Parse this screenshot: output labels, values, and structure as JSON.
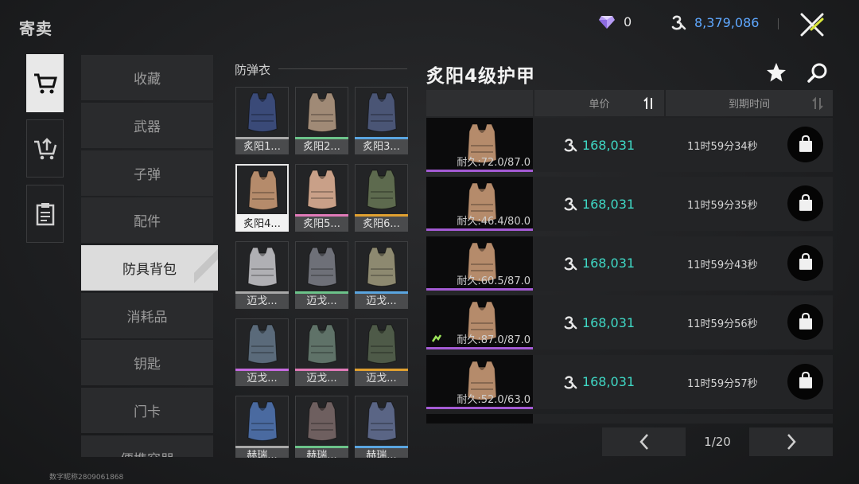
{
  "header": {
    "title": "寄卖",
    "gems": "0",
    "gold": "8,379,086"
  },
  "categories": [
    {
      "label": "收藏"
    },
    {
      "label": "武器"
    },
    {
      "label": "子弹"
    },
    {
      "label": "配件"
    },
    {
      "label": "防具背包"
    },
    {
      "label": "消耗品"
    },
    {
      "label": "钥匙"
    },
    {
      "label": "门卡"
    },
    {
      "label": "便携容器"
    }
  ],
  "grid": {
    "title": "防弹衣",
    "items": [
      {
        "label": "炙阳1...",
        "bar_color": "#a9a9a9",
        "vest_color": "#3a4a78"
      },
      {
        "label": "炙阳2...",
        "bar_color": "#6cc38a",
        "vest_color": "#a08a76"
      },
      {
        "label": "炙阳3...",
        "bar_color": "#5aa5e0",
        "vest_color": "#4a5575"
      },
      {
        "label": "炙阳4...",
        "bar_color": "#f2f2f2",
        "vest_color": "#b58b6b"
      },
      {
        "label": "炙阳5...",
        "bar_color": "#e07ab8",
        "vest_color": "#c9a088"
      },
      {
        "label": "炙阳6...",
        "bar_color": "#e0a030",
        "vest_color": "#5d6a4e"
      },
      {
        "label": "迈戈...",
        "bar_color": "#a9a9a9",
        "vest_color": "#b0b0b4"
      },
      {
        "label": "迈戈...",
        "bar_color": "#6cc38a",
        "vest_color": "#6e7078"
      },
      {
        "label": "迈戈...",
        "bar_color": "#5aa5e0",
        "vest_color": "#8d8970"
      },
      {
        "label": "迈戈...",
        "bar_color": "#c66ae0",
        "vest_color": "#5a6a7a"
      },
      {
        "label": "迈戈...",
        "bar_color": "#e07ab8",
        "vest_color": "#5f7268"
      },
      {
        "label": "迈戈...",
        "bar_color": "#e0a030",
        "vest_color": "#4e5a48"
      },
      {
        "label": "赫瑞...",
        "bar_color": "#a9a9a9",
        "vest_color": "#4a6aa0"
      },
      {
        "label": "赫瑞...",
        "bar_color": "#6cc38a",
        "vest_color": "#6e5f5f"
      },
      {
        "label": "赫瑞...",
        "bar_color": "#5aa5e0",
        "vest_color": "#5a6585"
      }
    ]
  },
  "detail": {
    "title": "炙阳4级护甲",
    "col_price": "单价",
    "col_expire": "到期时间",
    "listings": [
      {
        "durability": "耐久:72.0/87.0",
        "price": "168,031",
        "time": "11时59分34秒",
        "marked": false
      },
      {
        "durability": "耐久:46.4/80.0",
        "price": "168,031",
        "time": "11时59分35秒",
        "marked": false
      },
      {
        "durability": "耐久:60.5/87.0",
        "price": "168,031",
        "time": "11时59分43秒",
        "marked": false
      },
      {
        "durability": "耐久:87.0/87.0",
        "price": "168,031",
        "time": "11时59分56秒",
        "marked": true
      },
      {
        "durability": "耐久:52.0/63.0",
        "price": "168,031",
        "time": "11时59分57秒",
        "marked": false
      }
    ],
    "page": "1/20"
  },
  "watermark": "数字昵称2809061868",
  "colors": {
    "price": "#3fd8c5",
    "gold": "#5fa8ff",
    "rarity_purple": "#a45bd4"
  }
}
